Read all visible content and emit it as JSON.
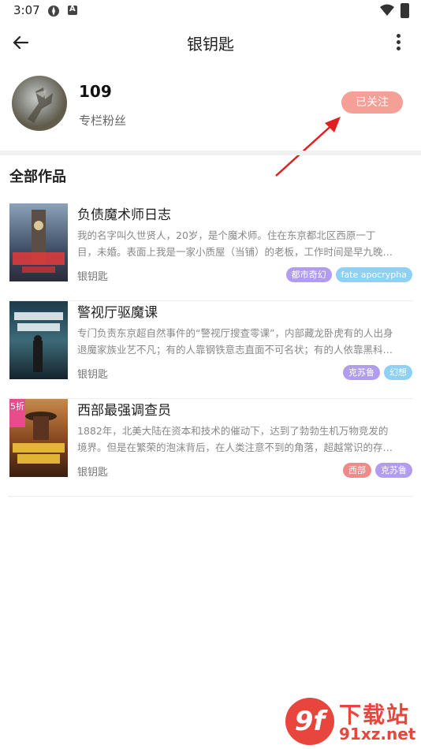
{
  "status": {
    "time": "3:07"
  },
  "header": {
    "title": "银钥匙"
  },
  "profile": {
    "followers_count": "109",
    "followers_label": "专栏粉丝",
    "follow_button": "已关注"
  },
  "section_title": "全部作品",
  "books": [
    {
      "title": "负债魔术师日志",
      "desc_line1": "我的名字叫久世贤人，20岁，是个魔术师。住在东京都北区西原一丁",
      "desc_line2": "目，未婚。表面上我是一家小质屋（当铺）的老板，工作时间是早九晚…",
      "author": "银钥匙",
      "tags": [
        {
          "label": "都市奇幻",
          "color": "#b29cf0"
        },
        {
          "label": "fate apocrypha",
          "color": "#8fd0f5"
        }
      ]
    },
    {
      "title": "警视厅驱魔课",
      "desc_line1": "专门负责东京超自然事件的“警视厅搜查零课”，内部藏龙卧虎有的人出身",
      "desc_line2": "退魔家族业艺不凡；有的人靠钢铁意志直面不可名状；有的人依靠黑科…",
      "author": "银钥匙",
      "tags": [
        {
          "label": "克苏鲁",
          "color": "#b29cf0"
        },
        {
          "label": "幻想",
          "color": "#8fd0f5"
        }
      ]
    },
    {
      "title": "西部最强调查员",
      "desc_line1": "1882年，北美大陆在资本和技术的催动下，达到了勃勃生机万物竞发的",
      "desc_line2": "境界。但是在繁荣的泡沫背后，在人类注意不到的角落，超越常识的存…",
      "author": "银钥匙",
      "discount": "5折",
      "tags": [
        {
          "label": "西部",
          "color": "#f08a8a"
        },
        {
          "label": "克苏鲁",
          "color": "#b29cf0"
        }
      ]
    }
  ],
  "watermark": {
    "logo": "9f",
    "text1": "下载站",
    "text2": "91xz.net"
  }
}
